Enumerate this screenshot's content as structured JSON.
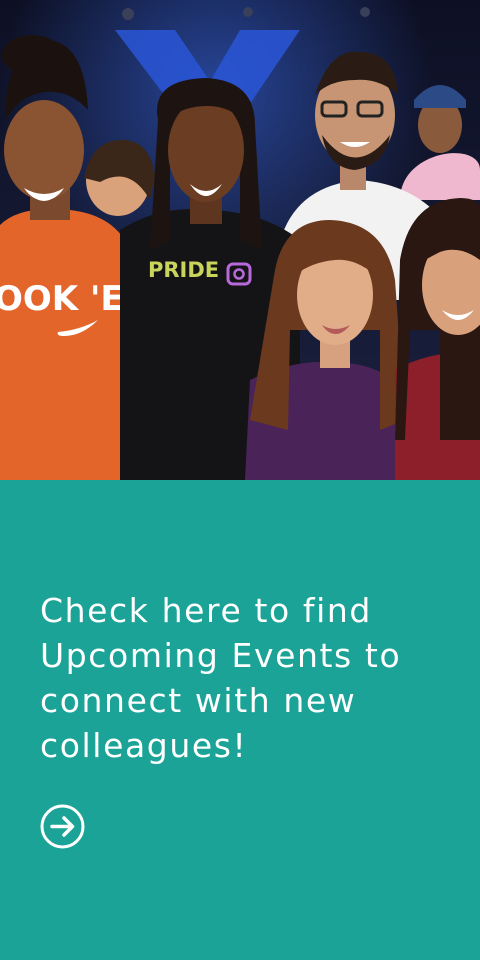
{
  "hero": {
    "shirt_left_text": "OOK 'EM",
    "shirt_center_text": "PRIDE",
    "icons": {
      "camera": "camera-icon",
      "swoosh": "swoosh-logo"
    }
  },
  "promo": {
    "message": "Check here to find Upcoming Events to connect with new colleagues!",
    "link_icon": "arrow-right-circle-icon"
  },
  "colors": {
    "panel": "#1aa396",
    "text": "#ffffff",
    "backdrop": "#12162e",
    "backdrop_logo": "#2a56d8"
  }
}
